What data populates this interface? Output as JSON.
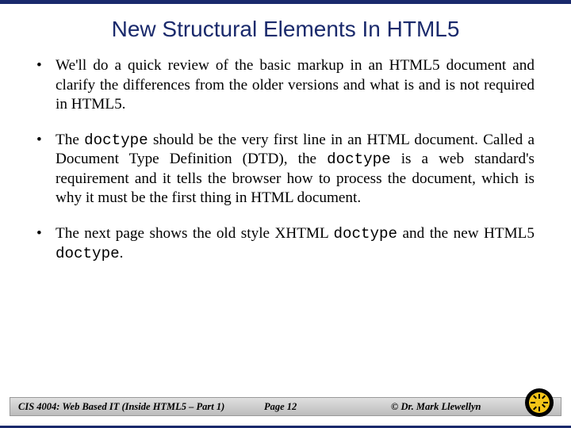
{
  "title": "New Structural Elements In HTML5",
  "bullets": {
    "b1_pre": "We'll do a quick review of the basic markup in an HTML5 document and clarify the differences from the older versions and what is and is not required in HTML5.",
    "b2_a": "The ",
    "b2_code1": "doctype",
    "b2_b": " should be the very first line in an HTML document.  Called a Document Type Definition (DTD), the ",
    "b2_code2": "doctype",
    "b2_c": " is a web standard's requirement and it tells the browser how to process the document, which is why it must be the first thing in HTML document.",
    "b3_a": "The next page shows the old style XHTML ",
    "b3_code1": "doctype",
    "b3_b": " and the new HTML5 ",
    "b3_code2": "doctype",
    "b3_c": "."
  },
  "footer": {
    "left": "CIS 4004: Web Based IT (Inside HTML5 – Part 1)",
    "center": "Page 12",
    "right": "© Dr. Mark Llewellyn"
  }
}
